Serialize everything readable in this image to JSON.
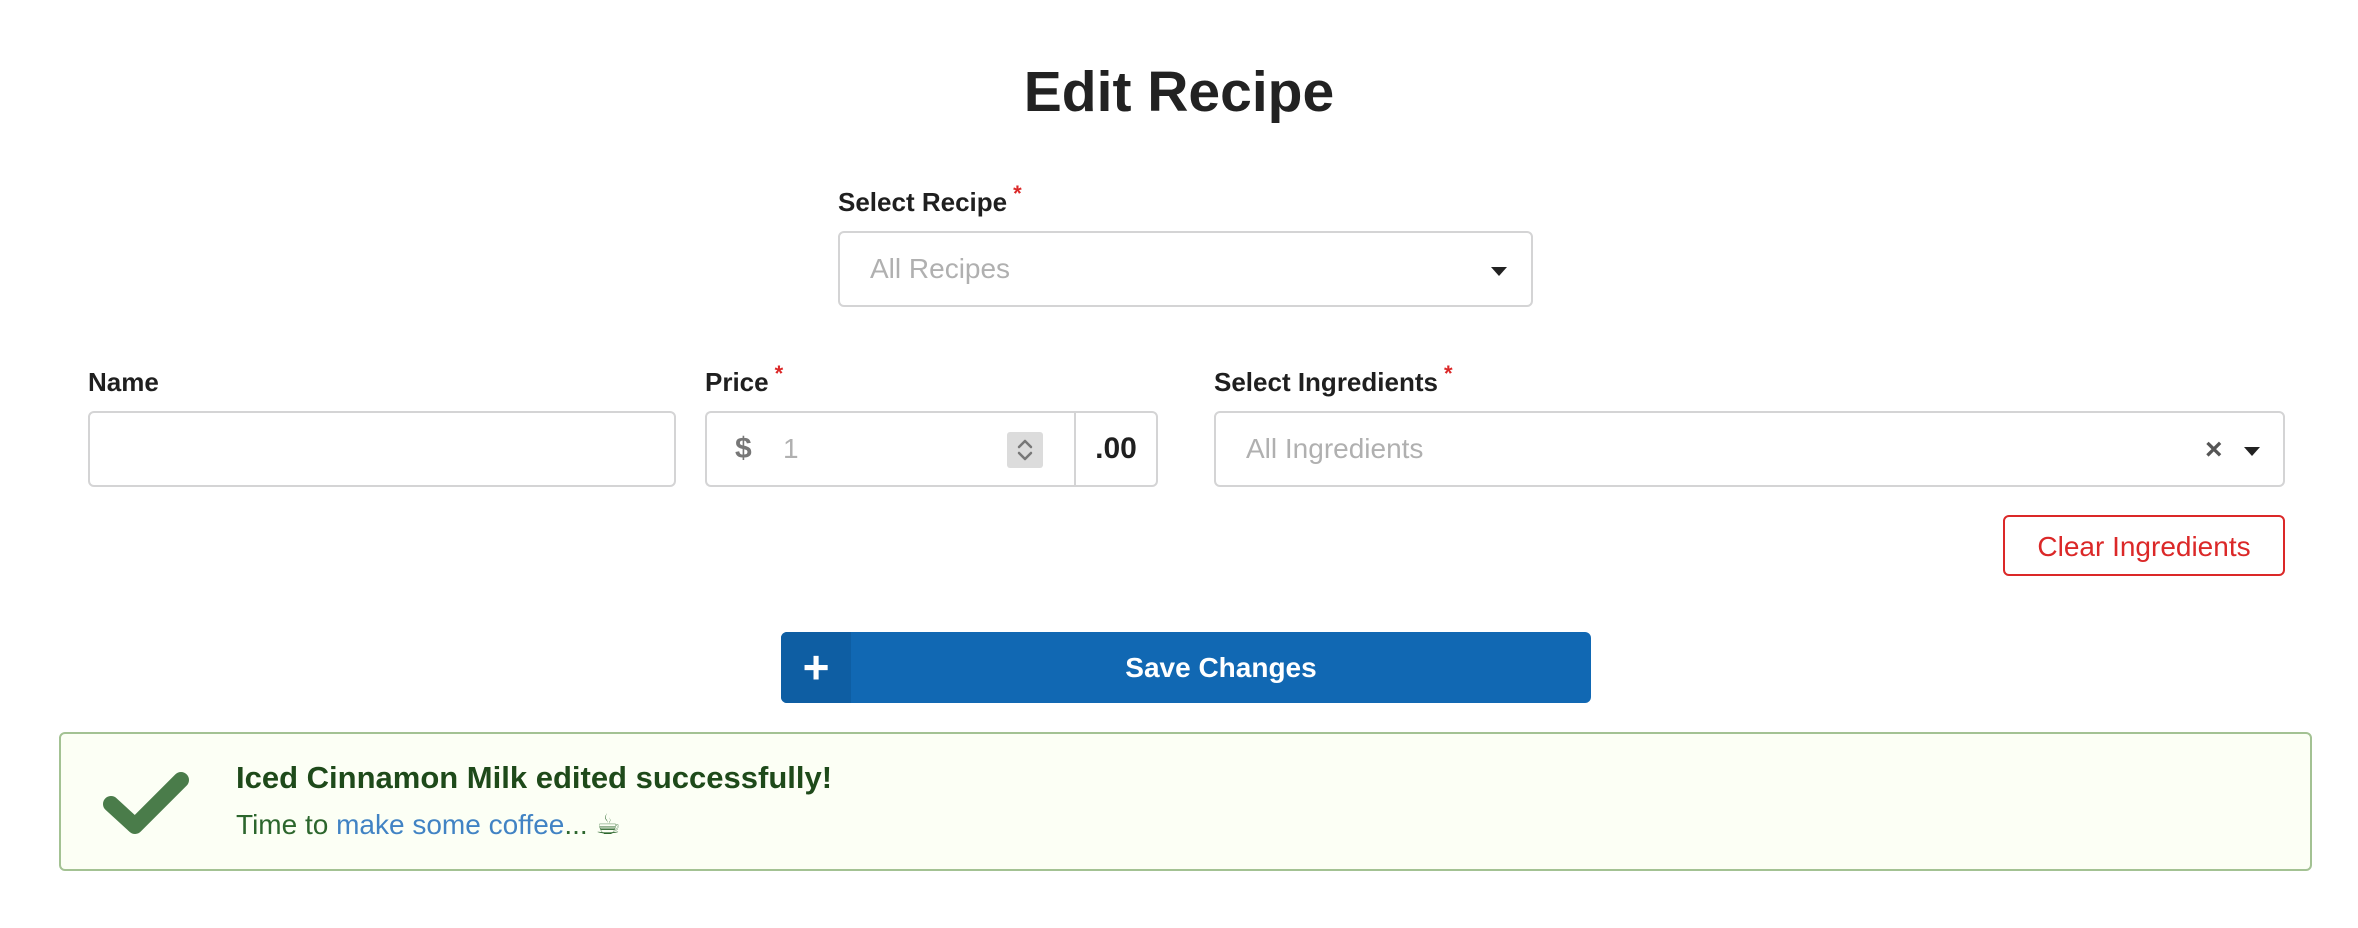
{
  "page": {
    "title": "Edit Recipe"
  },
  "recipe_select": {
    "label": "Select Recipe",
    "required_mark": "*",
    "placeholder": "All Recipes"
  },
  "name_field": {
    "label": "Name",
    "value": ""
  },
  "price_field": {
    "label": "Price",
    "required_mark": "*",
    "currency_symbol": "$",
    "placeholder": "1",
    "cents_suffix": ".00"
  },
  "ingredients_select": {
    "label": "Select Ingredients",
    "required_mark": "*",
    "placeholder": "All Ingredients",
    "clear_symbol": "×"
  },
  "clear_ingredients_button": {
    "label": "Clear Ingredients"
  },
  "save_button": {
    "icon_symbol": "+",
    "label": "Save Changes"
  },
  "success_message": {
    "header": "Iced Cinnamon Milk edited successfully!",
    "body_prefix": "Time to ",
    "link_text": "make some coffee",
    "body_suffix": "... ☕"
  },
  "colors": {
    "primary": "#1168b3",
    "danger": "#db2828",
    "success_border": "#a3c293",
    "success_bg": "#fcfff5",
    "success_icon": "#4a7c4a",
    "link": "#4183c4"
  },
  "icons": {
    "recipe_dropdown": "chevron-down-icon",
    "price_spinner": "up-down-arrows-icon",
    "ingredients_dropdown": "chevron-down-icon",
    "ingredients_clear": "close-icon",
    "save": "plus-icon",
    "success": "checkmark-icon"
  }
}
